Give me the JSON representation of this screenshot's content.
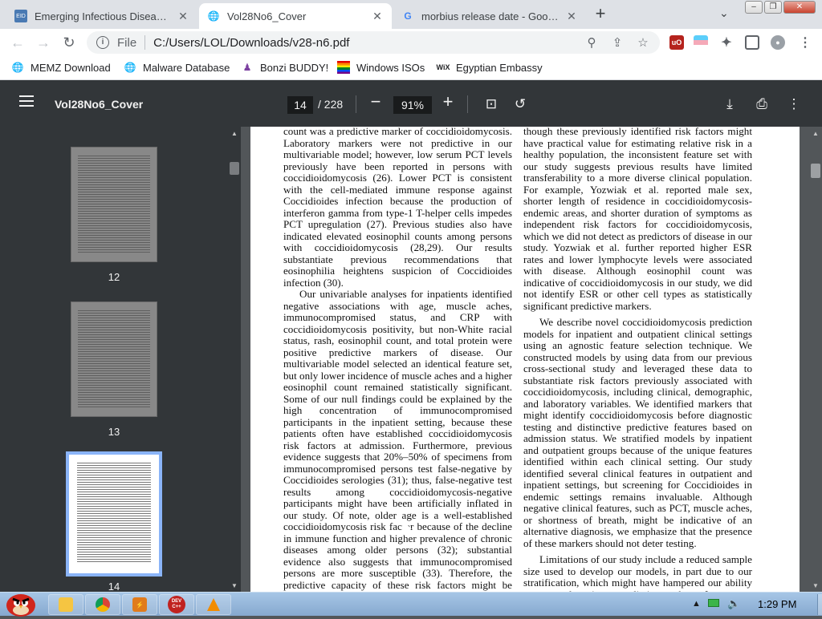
{
  "tabs": [
    {
      "title": "Emerging Infectious Diseases J",
      "icon": "eid-journal-icon",
      "active": false
    },
    {
      "title": "Vol28No6_Cover",
      "icon": "globe-icon",
      "active": true
    },
    {
      "title": "morbius release date - Google",
      "icon": "google-icon",
      "active": false
    }
  ],
  "window_controls": {
    "minimize": "–",
    "restore": "❐",
    "close": "✕"
  },
  "omnibox": {
    "scheme": "File",
    "url": "C:/Users/LOL/Downloads/v28-n6.pdf"
  },
  "bookmarks": [
    {
      "label": "MEMZ Download",
      "icon": "globe-icon"
    },
    {
      "label": "Malware Database",
      "icon": "globe-icon"
    },
    {
      "label": "Bonzi BUDDY!",
      "icon": "bonzi-icon"
    },
    {
      "label": "Windows ISOs",
      "icon": "rainbow-flag-icon"
    },
    {
      "label": "Egyptian Embassy",
      "icon": "wix-icon"
    }
  ],
  "pdf": {
    "title": "Vol28No6_Cover",
    "current_page": "14",
    "total_pages": "/ 228",
    "zoom": "91%"
  },
  "thumbnails": [
    {
      "label": "12"
    },
    {
      "label": "13"
    },
    {
      "label": "14"
    }
  ],
  "document": {
    "left_column": [
      "count was a predictive marker of coccidioidomycosis. Laboratory markers were not predictive in our multivariable model; however, low serum PCT levels previously have been reported in persons with coccidioidomycosis (26). Lower PCT is consistent with the cell-mediated immune response against Coccidioides infection because the production of interferon gamma from type-1 T-helper cells impedes PCT upregulation (27). Previous studies also have indicated elevated eosinophil counts among persons with coccidioidomycosis (28,29). Our results substantiate previous recommendations that eosinophilia heightens suspicion of Coccidioides infection (30).",
      "Our univariable analyses for inpatients identified negative associations with age, muscle aches, immunocompromised status, and CRP with coccidioidomycosis positivity, but non-White racial status, rash, eosinophil count, and total protein were positive predictive markers of disease. Our multivariable model selected an identical feature set, but only lower incidence of muscle aches and a higher eosinophil count remained statistically significant. Some of our null findings could be explained by the high concentration of immunocompromised participants in the inpatient setting, because these patients often have established coccidioidomycosis risk factors at admission. Furthermore, previous evidence suggests that 20%–50% of specimens from immunocompromised persons test false-negative by Coccidioides serologies (31); thus, false-negative test results among coccidioidomycosis-negative participants might have been artificially inflated in our study. Of note, older age is a well-established coccidioidomycosis risk factor because of the decline in immune function and higher prevalence of chronic diseases among older persons (32); substantial evidence also suggests that immunocompromised persons are more susceptible (33). Therefore, the predictive capacity of these risk factors might be limited by the intersecting clinical patterns of coccidioidomycosis and other diseases in the"
    ],
    "right_column": [
      "though these previously identified risk factors might have practical value for estimating relative risk in a healthy population, the inconsistent feature set with our study suggests previous results have limited transferability to a more diverse clinical population. For example, Yozwiak et al. reported male sex, shorter length of residence in coccidioidomycosis-endemic areas, and shorter duration of symptoms as independent risk factors for coccidioidomycosis, which we did not detect as predictors of disease in our study. Yozwiak et al. further reported higher ESR rates and lower lymphocyte levels were associated with disease. Although eosinophil count was indicative of coccidioidomycosis in our study, we did not identify ESR or other cell types as statistically significant predictive markers.",
      "We describe novel coccidioidomycosis prediction models for inpatient and outpatient clinical settings using an agnostic feature selection technique. We constructed models by using data from our previous cross-sectional study and leveraged these data to substantiate risk factors previously associated with coccidioidomycosis, including clinical, demographic, and laboratory variables. We identified markers that might identify coccidioidomycosis before diagnostic testing and distinctive predictive features based on admission status. We stratified models by inpatient and outpatient groups because of the unique features identified within each clinical setting. Our study identified several clinical features in outpatient and inpatient settings, but screening for Coccidioides in endemic settings remains invaluable. Although negative clinical features, such as PCT, muscle aches, or shortness of breath, might be indicative of an alternative diagnosis, we emphasize that the presence of these markers should not deter testing.",
      "Limitations of our study include a reduced sample size used to develop our models, in part due to our stratification, which might have hampered our ability to accurately estimate predictive markers of"
    ]
  },
  "taskbar": {
    "clock": "1:29 PM",
    "apps": [
      {
        "name": "explorer",
        "icon": "folder-icon"
      },
      {
        "name": "chrome",
        "icon": "chrome-icon"
      },
      {
        "name": "winamp",
        "icon": "winamp-icon"
      },
      {
        "name": "devcpp",
        "icon": "devcpp-icon",
        "text": "DEV C++"
      },
      {
        "name": "vlc",
        "icon": "vlc-icon"
      }
    ]
  },
  "colors": {
    "pdf_toolbar": "#323639",
    "pdf_bg": "#525659",
    "selected_thumb_border": "#8ab4f8",
    "tabstrip": "#dee1e6"
  }
}
